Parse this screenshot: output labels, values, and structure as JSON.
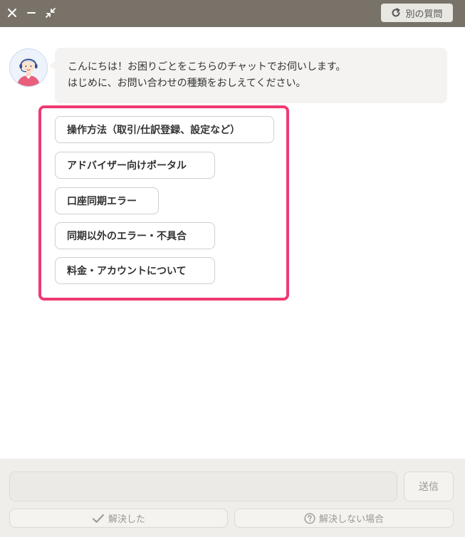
{
  "titlebar": {
    "new_question_label": "別の質問"
  },
  "chat": {
    "bot_message_line1": "こんにちは！お困りごとをこちらのチャットでお伺いします。",
    "bot_message_line2": "はじめに、お問い合わせの種類をおしえてください。",
    "options": [
      {
        "label": "操作方法（取引/仕訳登録、設定など）"
      },
      {
        "label": "アドバイザー向けポータル"
      },
      {
        "label": "口座同期エラー"
      },
      {
        "label": "同期以外のエラー・不具合"
      },
      {
        "label": "料金・アカウントについて"
      }
    ]
  },
  "footer": {
    "input_value": "",
    "input_placeholder": "",
    "send_label": "送信",
    "resolved_label": "解決した",
    "unresolved_label": "解決しない場合"
  },
  "colors": {
    "titlebar": "#787268",
    "highlight_border": "#ef3a72",
    "bubble_bg": "#f4f3f2",
    "footer_bg": "#efeeea"
  },
  "icons": {
    "close": "close-icon",
    "minimize": "minimize-icon",
    "shrink": "shrink-icon",
    "refresh": "refresh-icon",
    "check": "check-icon",
    "help": "help-circle-icon",
    "avatar": "operator-avatar"
  }
}
